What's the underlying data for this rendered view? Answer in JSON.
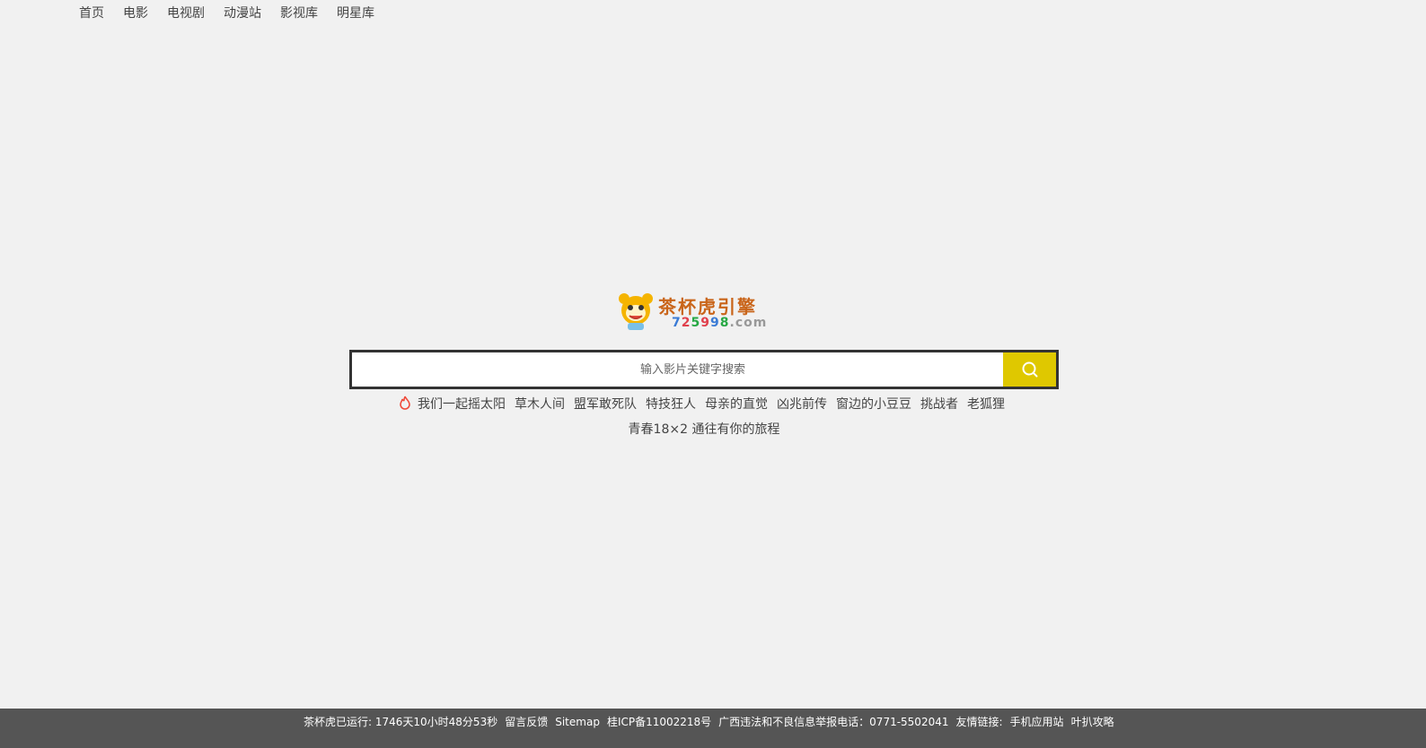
{
  "nav": [
    "首页",
    "电影",
    "电视剧",
    "动漫站",
    "影视库",
    "明星库"
  ],
  "logo": {
    "title": "茶杯虎引擎",
    "domain": [
      "7",
      "2",
      "5",
      "9",
      "9",
      "8",
      ".com"
    ],
    "domain_colors": [
      "#3a7bd5",
      "#e0404c",
      "#27a844",
      "#e0404c",
      "#3a7bd5",
      "#27a844",
      "#999999"
    ]
  },
  "search": {
    "placeholder": "输入影片关键字搜索",
    "button_icon": "search-icon",
    "button_color": "#dfc800"
  },
  "hot_words": {
    "icon": "fire-icon",
    "items": [
      "我们一起摇太阳",
      "草木人间",
      "盟军敢死队",
      "特技狂人",
      "母亲的直觉",
      "凶兆前传",
      "窗边的小豆豆",
      "挑战者",
      "老狐狸"
    ],
    "second_line": "青春18×2 通往有你的旅程"
  },
  "footer": {
    "runtime": "茶杯虎已运行: 1746天10小时48分53秒",
    "feedback": "留言反馈",
    "sitemap": "Sitemap",
    "icp": "桂ICP备11002218号",
    "report": "广西违法和不良信息举报电话：0771-5502041",
    "links_label": "友情链接:",
    "links": [
      "手机应用站",
      "叶扒攻略"
    ]
  }
}
